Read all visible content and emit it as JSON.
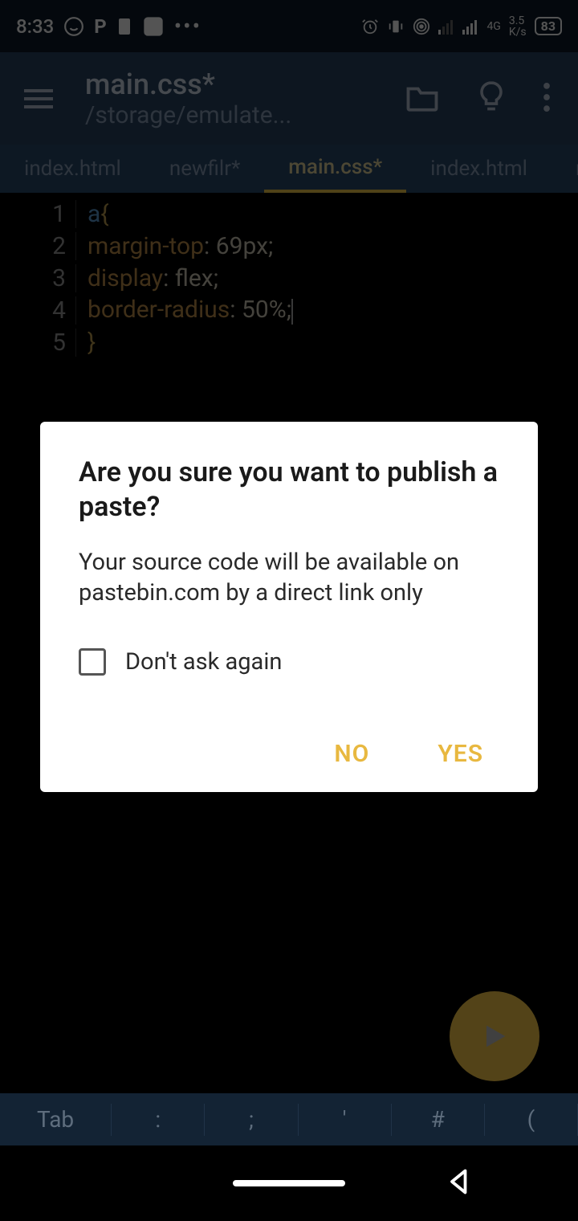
{
  "status": {
    "clock": "8:33",
    "network_tech": "4G",
    "net_speed": "3.5",
    "net_unit": "K/s",
    "battery": "83"
  },
  "header": {
    "title": "main.css*",
    "subtitle": "/storage/emulate..."
  },
  "tabs": [
    {
      "label": "index.html",
      "active": false
    },
    {
      "label": "newfilr*",
      "active": false
    },
    {
      "label": "main.css*",
      "active": true
    },
    {
      "label": "index.html",
      "active": false
    },
    {
      "label": "new",
      "active": false
    }
  ],
  "editor": {
    "lines": [
      {
        "num": "1",
        "spans": [
          {
            "t": "a",
            "c": "tok-sel"
          },
          {
            "t": "{",
            "c": "tok-brace"
          }
        ]
      },
      {
        "num": "2",
        "spans": [
          {
            "t": "margin-top",
            "c": "tok-prop"
          },
          {
            "t": ": ",
            "c": "tok-punc"
          },
          {
            "t": "69px",
            "c": "tok-val"
          },
          {
            "t": ";",
            "c": "tok-punc"
          }
        ]
      },
      {
        "num": "3",
        "spans": [
          {
            "t": "display",
            "c": "tok-prop"
          },
          {
            "t": ": ",
            "c": "tok-punc"
          },
          {
            "t": "flex",
            "c": "tok-val"
          },
          {
            "t": ";",
            "c": "tok-punc"
          }
        ]
      },
      {
        "num": "4",
        "spans": [
          {
            "t": "border-radius",
            "c": "tok-prop"
          },
          {
            "t": ": ",
            "c": "tok-punc"
          },
          {
            "t": "50%",
            "c": "tok-val"
          },
          {
            "t": ";",
            "c": "tok-punc"
          }
        ],
        "cursor": true
      },
      {
        "num": "5",
        "spans": [
          {
            "t": "}",
            "c": "tok-brace"
          }
        ]
      }
    ]
  },
  "dialog": {
    "title": "Are you sure you want to publish a paste?",
    "body": "Your source code will be available on pastebin.com by a direct link only",
    "checkbox_label": "Don't ask again",
    "no": "NO",
    "yes": "YES"
  },
  "bottom": {
    "items": [
      "Tab",
      ":",
      ";",
      "'",
      "#",
      "("
    ]
  }
}
